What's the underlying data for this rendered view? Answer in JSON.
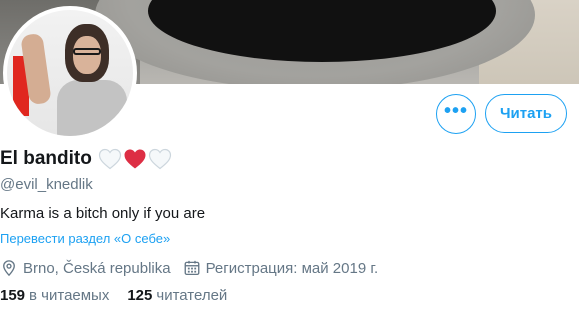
{
  "profile": {
    "name": "El bandito",
    "handle": "@evil_knedlik",
    "bio": "Karma is a bitch only if you are",
    "translate_link": "Перевести раздел «О себе»",
    "location": "Brno, Česká republika",
    "joined": "Регистрация: май 2019 г.",
    "name_emoji": [
      "white-heart",
      "red-heart",
      "white-heart"
    ]
  },
  "actions": {
    "more_label": "•••",
    "follow_label": "Читать"
  },
  "stats": {
    "following_count": "159",
    "following_label": "в читаемых",
    "followers_count": "125",
    "followers_label": "читателей"
  },
  "icons": {
    "location": "location-pin-icon",
    "calendar": "calendar-icon"
  },
  "colors": {
    "accent": "#1da1f2",
    "secondary_text": "#657786",
    "primary_text": "#14171a",
    "heart_red": "#e0245e"
  }
}
